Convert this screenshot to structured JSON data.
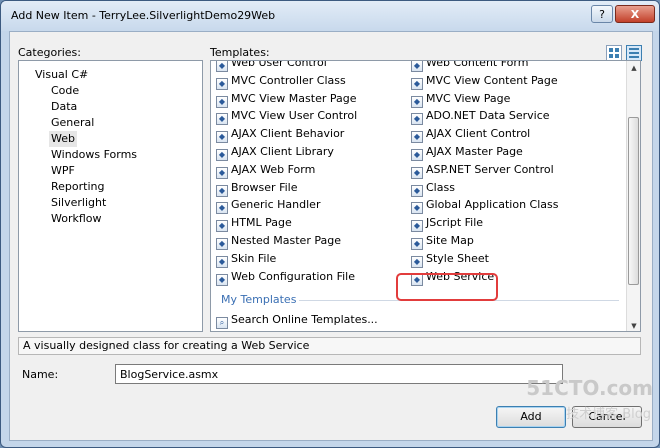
{
  "window": {
    "title": "Add New Item - TerryLee.SilverlightDemo29Web",
    "help_label": "?",
    "close_label": "X"
  },
  "categories": {
    "label": "Categories:",
    "items": [
      {
        "label": "Visual C#",
        "indent": 0,
        "selected": false
      },
      {
        "label": "Code",
        "indent": 1,
        "selected": false
      },
      {
        "label": "Data",
        "indent": 1,
        "selected": false
      },
      {
        "label": "General",
        "indent": 1,
        "selected": false
      },
      {
        "label": "Web",
        "indent": 1,
        "selected": true
      },
      {
        "label": "Windows Forms",
        "indent": 1,
        "selected": false
      },
      {
        "label": "WPF",
        "indent": 1,
        "selected": false
      },
      {
        "label": "Reporting",
        "indent": 1,
        "selected": false
      },
      {
        "label": "Silverlight",
        "indent": 1,
        "selected": false
      },
      {
        "label": "Workflow",
        "indent": 1,
        "selected": false
      }
    ]
  },
  "templates": {
    "label": "Templates:",
    "left": [
      {
        "label": "Web User Control",
        "icon": "web-user-control-icon"
      },
      {
        "label": "MVC Controller Class",
        "icon": "mvc-controller-icon"
      },
      {
        "label": "MVC View Master Page",
        "icon": "mvc-master-page-icon"
      },
      {
        "label": "MVC View User Control",
        "icon": "mvc-user-control-icon"
      },
      {
        "label": "AJAX Client Behavior",
        "icon": "ajax-behavior-icon"
      },
      {
        "label": "AJAX Client Library",
        "icon": "ajax-library-icon"
      },
      {
        "label": "AJAX Web Form",
        "icon": "ajax-web-form-icon"
      },
      {
        "label": "Browser File",
        "icon": "browser-file-icon"
      },
      {
        "label": "Generic Handler",
        "icon": "generic-handler-icon"
      },
      {
        "label": "HTML Page",
        "icon": "html-page-icon"
      },
      {
        "label": "Nested Master Page",
        "icon": "nested-master-page-icon"
      },
      {
        "label": "Skin File",
        "icon": "skin-file-icon"
      },
      {
        "label": "Web Configuration File",
        "icon": "web-config-icon"
      }
    ],
    "right": [
      {
        "label": "Web Content Form",
        "icon": "web-content-form-icon"
      },
      {
        "label": "MVC View Content Page",
        "icon": "mvc-content-page-icon"
      },
      {
        "label": "MVC View Page",
        "icon": "mvc-view-page-icon"
      },
      {
        "label": "ADO.NET Data Service",
        "icon": "data-service-icon"
      },
      {
        "label": "AJAX Client Control",
        "icon": "ajax-control-icon"
      },
      {
        "label": "AJAX Master Page",
        "icon": "ajax-master-page-icon"
      },
      {
        "label": "ASP.NET Server Control",
        "icon": "server-control-icon"
      },
      {
        "label": "Class",
        "icon": "class-icon"
      },
      {
        "label": "Global Application Class",
        "icon": "global-app-class-icon"
      },
      {
        "label": "JScript File",
        "icon": "jscript-file-icon"
      },
      {
        "label": "Site Map",
        "icon": "site-map-icon"
      },
      {
        "label": "Style Sheet",
        "icon": "style-sheet-icon"
      },
      {
        "label": "Web Service",
        "icon": "web-service-icon",
        "selected": true
      }
    ],
    "my_templates_label": "My Templates",
    "search_online_label": "Search Online Templates..."
  },
  "description": "A visually designed class for creating a Web Service",
  "name": {
    "label": "Name:",
    "value": "BlogService.asmx"
  },
  "buttons": {
    "add": "Add",
    "cancel": "Cancel"
  },
  "watermark": {
    "line1": "51CTO.com",
    "line2": "技术博客 Blog"
  },
  "colors": {
    "highlight_border": "#e23c3c",
    "my_templates_text": "#3a6fb3"
  }
}
